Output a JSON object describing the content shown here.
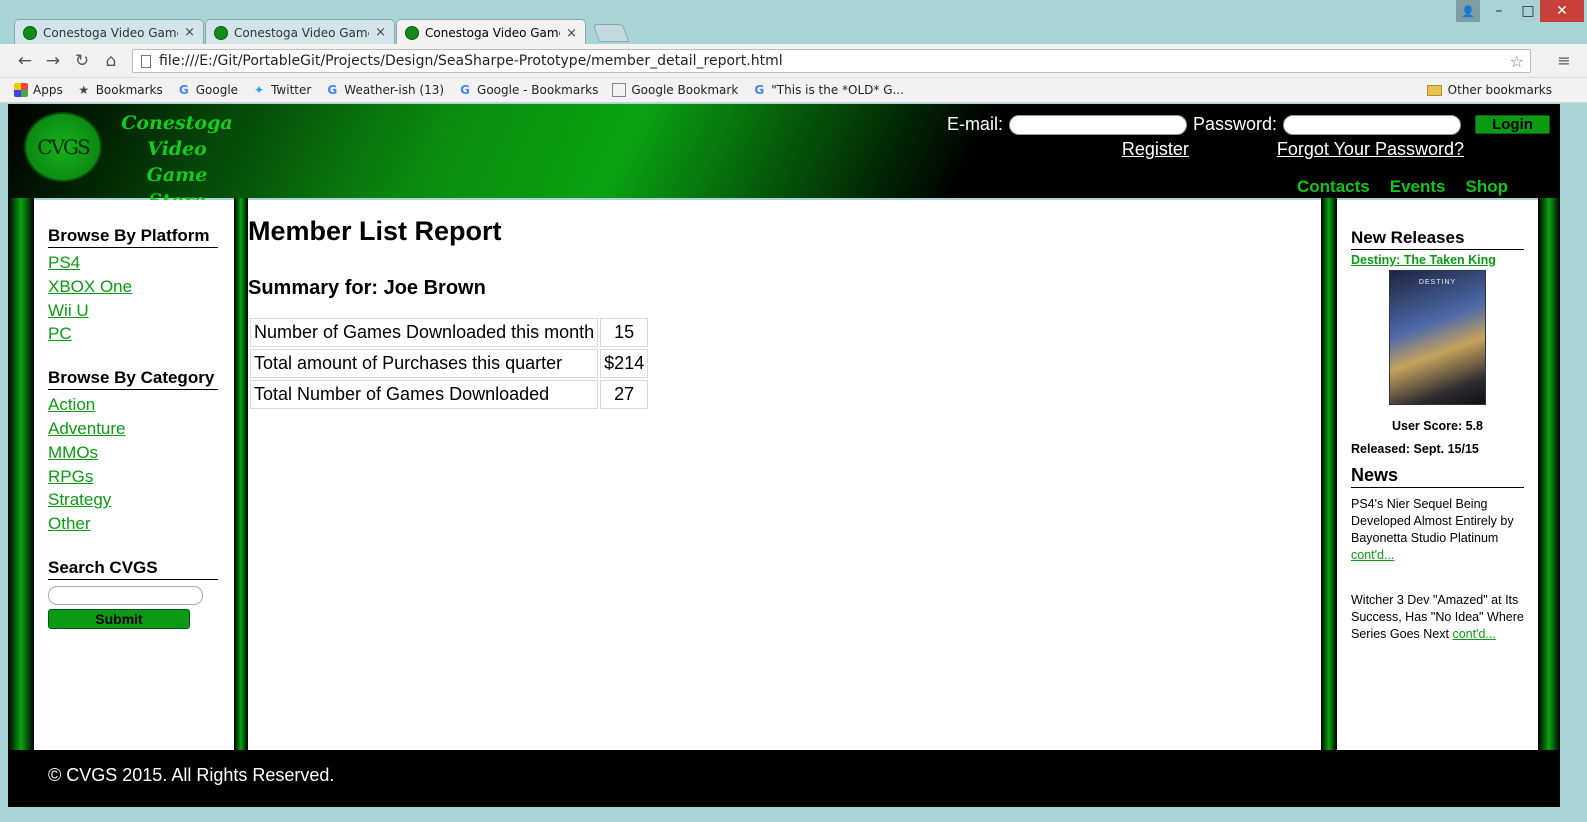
{
  "browser": {
    "tabs": [
      {
        "title": "Conestoga Video Game St",
        "active": false
      },
      {
        "title": "Conestoga Video Game St",
        "active": false
      },
      {
        "title": "Conestoga Video Game St",
        "active": true
      }
    ],
    "url": "file:///E:/Git/PortableGit/Projects/Design/SeaSharpe-Prototype/member_detail_report.html",
    "bookmarks": [
      {
        "label": "Apps",
        "icon": "apps-icon"
      },
      {
        "label": "Bookmarks",
        "icon": "star-icon"
      },
      {
        "label": "Google",
        "icon": "google-icon"
      },
      {
        "label": "Twitter",
        "icon": "twitter-icon"
      },
      {
        "label": "Weather-ish (13)",
        "icon": "google-icon"
      },
      {
        "label": "Google - Bookmarks",
        "icon": "google-icon"
      },
      {
        "label": "Google Bookmark",
        "icon": "page-icon"
      },
      {
        "label": "\"This is the *OLD* G...",
        "icon": "google-icon"
      }
    ],
    "other_bookmarks": "Other bookmarks"
  },
  "site": {
    "logo_mark": "CVGS",
    "logo_lines": [
      "Conestoga",
      "Video Game",
      "Store"
    ],
    "login": {
      "email_label": "E-mail:",
      "password_label": "Password:",
      "login_button": "Login",
      "register": "Register",
      "forgot": "Forgot Your Password?"
    },
    "nav": [
      "Contacts",
      "Events",
      "Shop"
    ],
    "left": {
      "platform_heading": "Browse By Platform",
      "platforms": [
        "PS4",
        "XBOX One",
        "Wii U",
        "PC"
      ],
      "category_heading": "Browse By Category",
      "categories": [
        "Action",
        "Adventure",
        "MMOs",
        "RPGs",
        "Strategy",
        "Other"
      ],
      "search_heading": "Search CVGS",
      "submit": "Submit"
    },
    "main": {
      "title": "Member List Report",
      "summary": "Summary for: Joe Brown",
      "rows": [
        {
          "label": "Number of Games Downloaded this month",
          "value": "15"
        },
        {
          "label": "Total amount of Purchases this quarter",
          "value": "$214"
        },
        {
          "label": "Total Number of Games Downloaded",
          "value": "27"
        }
      ]
    },
    "right": {
      "new_releases_heading": "New Releases",
      "release_title": "Destiny: The Taken King",
      "cover_text": "DESTINY",
      "user_score": "User Score: 5.8",
      "released": "Released: Sept. 15/15",
      "news_heading": "News",
      "news": [
        {
          "text": "PS4's Nier Sequel Being Developed Almost Entirely by Bayonetta Studio Platinum",
          "link": "cont'd..."
        },
        {
          "text": "Witcher 3 Dev \"Amazed\" at Its Success, Has \"No Idea\" Where Series Goes Next",
          "link": "cont'd..."
        }
      ]
    },
    "footer": "© CVGS 2015. All Rights Reserved."
  },
  "colors": {
    "brand_green": "#0d9a14",
    "header_black": "#000000"
  }
}
